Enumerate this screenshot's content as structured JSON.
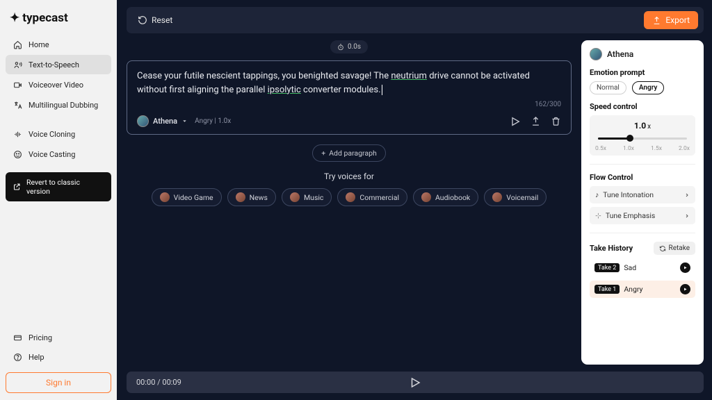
{
  "brand": "typecast",
  "nav": {
    "home": "Home",
    "tts": "Text-to-Speech",
    "vo": "Voiceover Video",
    "dub": "Multilingual Dubbing",
    "clone": "Voice Cloning",
    "cast": "Voice Casting",
    "revert": "Revert to classic version",
    "pricing": "Pricing",
    "help": "Help",
    "signin": "Sign in"
  },
  "topbar": {
    "reset": "Reset",
    "export": "Export"
  },
  "editor": {
    "timer": "0.0s",
    "text_a": "Cease your futile nescient tappings, you benighted savage! The ",
    "text_b": "neutrium",
    "text_c": " drive cannot be activated without first aligning the parallel ",
    "text_d": "ipsolytic",
    "text_e": " converter modules.",
    "count": "162/300",
    "voice_name": "Athena",
    "voice_meta": "Angry  |  1.0x",
    "add_paragraph": "Add paragraph",
    "try_heading": "Try voices for",
    "pills": [
      "Video Game",
      "News",
      "Music",
      "Commercial",
      "Audiobook",
      "Voicemail"
    ]
  },
  "inspector": {
    "voice_name": "Athena",
    "emotion_title": "Emotion prompt",
    "emotions": {
      "normal": "Normal",
      "angry": "Angry"
    },
    "speed_title": "Speed control",
    "speed_value": "1.0",
    "speed_suffix": "x",
    "speed_labels": [
      "0.5x",
      "1.0x",
      "1.5x",
      "2.0x"
    ],
    "flow_title": "Flow Control",
    "flow1": "Tune Intonation",
    "flow2": "Tune Emphasis",
    "take_title": "Take History",
    "retake": "Retake",
    "takes": [
      {
        "badge": "Take 2",
        "label": "Sad"
      },
      {
        "badge": "Take 1",
        "label": "Angry"
      }
    ]
  },
  "playbar": {
    "time": "00:00 / 00:09"
  }
}
